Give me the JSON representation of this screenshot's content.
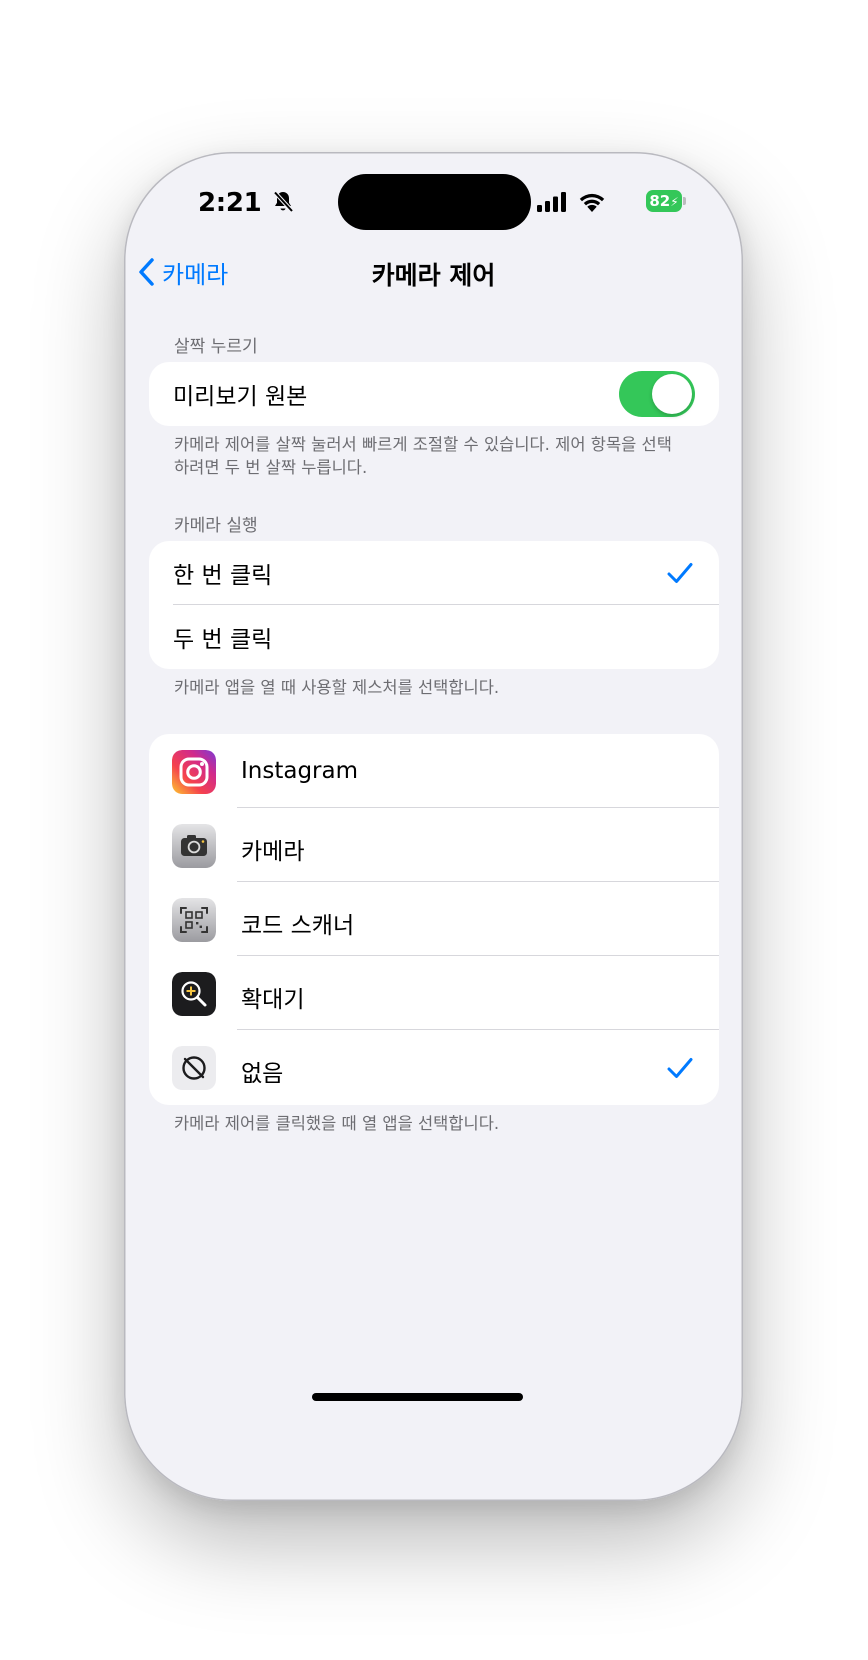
{
  "status_bar": {
    "time": "2:21",
    "battery": "82",
    "icons": [
      "bell-slash-icon",
      "cellular-signal-icon",
      "wifi-icon",
      "battery-charging-icon"
    ]
  },
  "nav": {
    "back_label": "카메라",
    "title": "카메라 제어"
  },
  "light_press": {
    "header": "살짝 누르기",
    "toggle_label": "미리보기 원본",
    "toggle_on": true,
    "footer": "카메라 제어를 살짝 눌러서 빠르게 조절할 수 있습니다. 제어 항목을 선택하려면 두 번 살짝 누릅니다."
  },
  "launch": {
    "header": "카메라 실행",
    "options": [
      {
        "label": "한 번 클릭",
        "selected": true
      },
      {
        "label": "두 번 클릭",
        "selected": false
      }
    ],
    "footer": "카메라 앱을 열 때 사용할 제스처를 선택합니다."
  },
  "apps": {
    "items": [
      {
        "label": "Instagram",
        "icon": "instagram-icon",
        "selected": false
      },
      {
        "label": "카메라",
        "icon": "camera-app-icon",
        "selected": false
      },
      {
        "label": "코드 스캐너",
        "icon": "code-scanner-icon",
        "selected": false
      },
      {
        "label": "확대기",
        "icon": "magnifier-icon",
        "selected": false
      },
      {
        "label": "없음",
        "icon": "none-icon",
        "selected": true
      }
    ],
    "footer": "카메라 제어를 클릭했을 때 열 앱을 선택합니다."
  },
  "colors": {
    "accent": "#007aff",
    "toggle_on": "#34c759",
    "background": "#f2f2f7"
  }
}
